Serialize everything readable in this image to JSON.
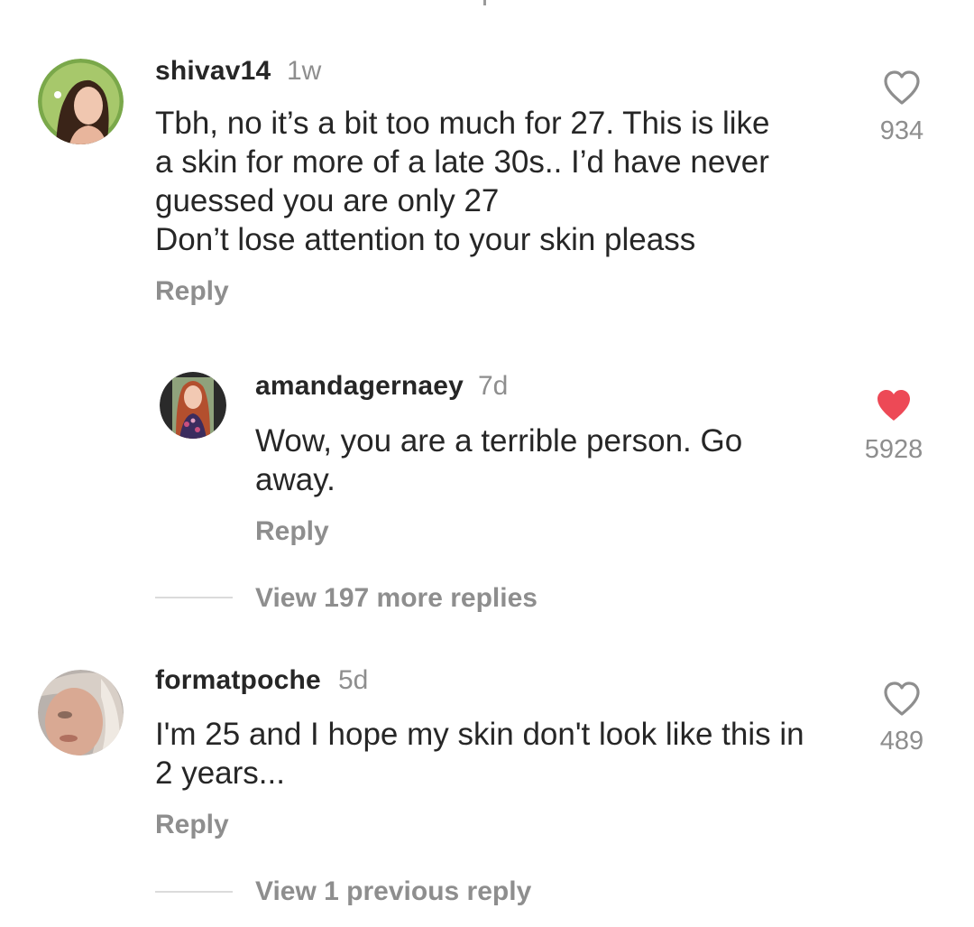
{
  "comments": [
    {
      "username": "shivav14",
      "time": "1w",
      "text_lines": [
        "Tbh, no it’s a bit too much for 27. This is like",
        "a skin for more of a late 30s.. I’d have never",
        "guessed you are only 27",
        "Don’t lose attention to your skin pleass"
      ],
      "reply_label": "Reply",
      "likes": "934",
      "liked": false
    },
    {
      "username": "amandagernaey",
      "time": "7d",
      "text_lines": [
        "Wow, you are a terrible person. Go",
        "away."
      ],
      "reply_label": "Reply",
      "likes": "5928",
      "liked": true
    },
    {
      "username": "formatpoche",
      "time": "5d",
      "text_lines": [
        "I'm 25 and I hope my skin don't look like this in",
        "2 years..."
      ],
      "reply_label": "Reply",
      "likes": "489",
      "liked": false
    }
  ],
  "view_more_replies": "View 197 more replies",
  "view_previous_reply": "View 1 previous reply",
  "colors": {
    "text": "#262626",
    "secondary": "#8e8e8e",
    "liked_heart": "#ed4956",
    "divider": "#dbdbdb"
  },
  "icons": [
    "heart-outline-icon",
    "heart-filled-icon"
  ]
}
